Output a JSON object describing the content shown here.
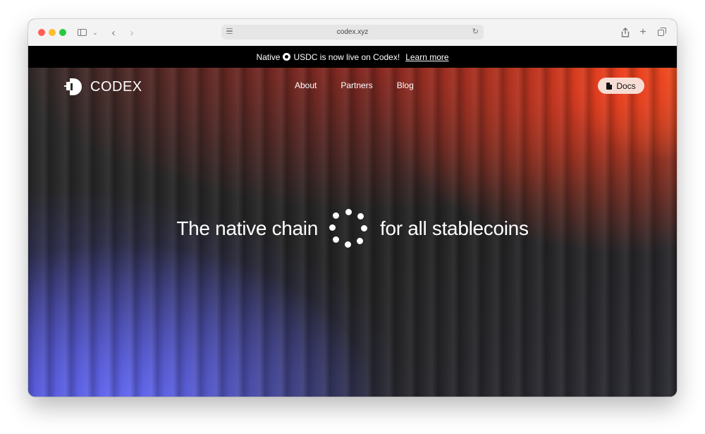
{
  "browser": {
    "url": "codex.xyz",
    "icons": [
      "sidebar-icon",
      "chevron-down-icon",
      "back-icon",
      "forward-icon",
      "reload-icon",
      "share-icon",
      "plus-icon",
      "tabs-icon"
    ]
  },
  "announcement": {
    "prefix": "Native",
    "suffix": "USDC is now live on Codex!",
    "link": "Learn more",
    "icon": "usdc-coin-icon"
  },
  "nav": {
    "brand": "CODEX",
    "links": [
      "About",
      "Partners",
      "Blog"
    ],
    "docs_label": "Docs",
    "docs_icon": "document-icon"
  },
  "hero": {
    "headline_left": "The native chain",
    "headline_right": "for all stablecoins",
    "icon": "dotted-circle-icon"
  },
  "colors": {
    "accent_red": "#f03c1e",
    "accent_blue": "#686eff",
    "docs_button_bg": "#f7ddd3"
  }
}
